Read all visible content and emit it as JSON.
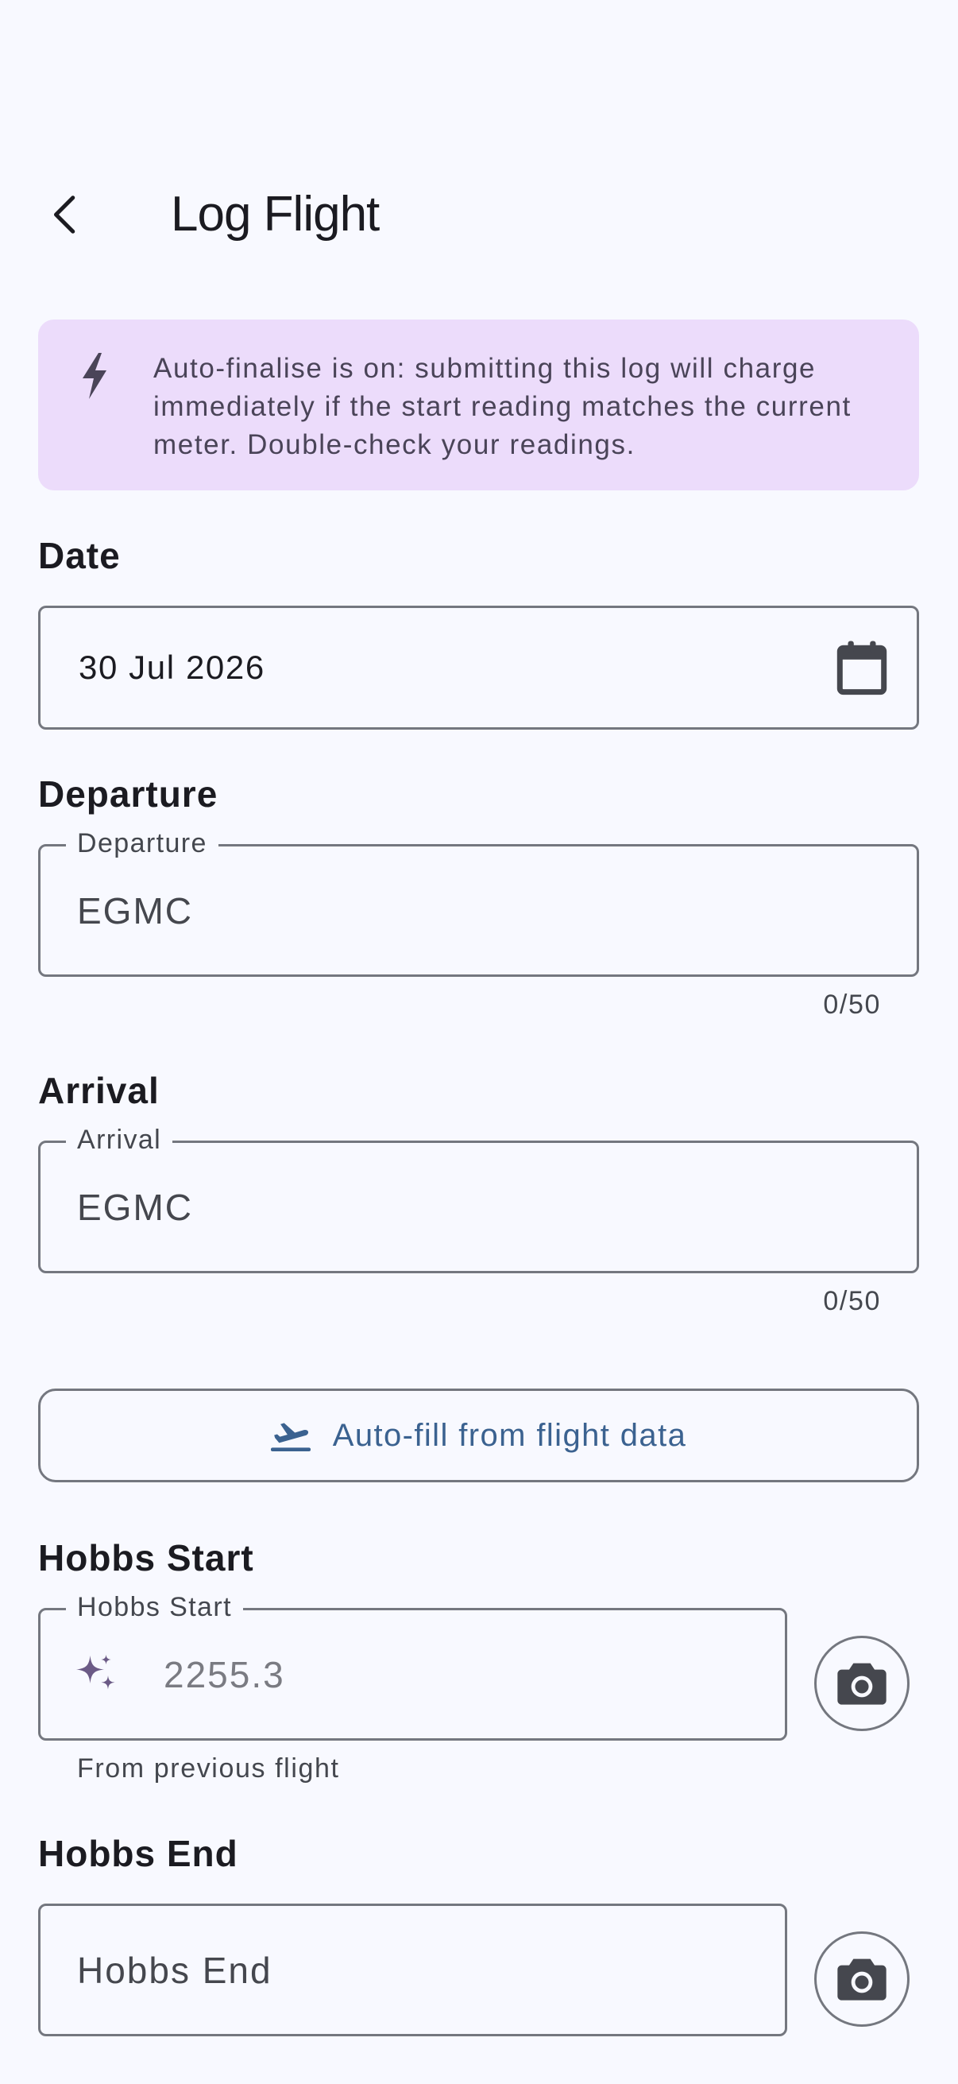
{
  "header": {
    "title": "Log Flight"
  },
  "banner": {
    "text": "Auto-finalise is on: submitting this log will charge immediately if the start reading matches the current meter. Double-check your readings."
  },
  "date": {
    "section_label": "Date",
    "value": "30 Jul 2026"
  },
  "departure": {
    "section_label": "Departure",
    "field_label": "Departure",
    "value": "EGMC",
    "counter": "0/50"
  },
  "arrival": {
    "section_label": "Arrival",
    "field_label": "Arrival",
    "value": "EGMC",
    "counter": "0/50"
  },
  "autofill": {
    "label": "Auto-fill from flight data"
  },
  "hobbs_start": {
    "section_label": "Hobbs Start",
    "field_label": "Hobbs Start",
    "value": "2255.3",
    "helper": "From previous flight"
  },
  "hobbs_end": {
    "section_label": "Hobbs End",
    "placeholder": "Hobbs End"
  },
  "colors": {
    "background": "#F8F9FF",
    "banner": "#ECDCFB",
    "accent": "#3B6290",
    "outline": "#74777F"
  }
}
